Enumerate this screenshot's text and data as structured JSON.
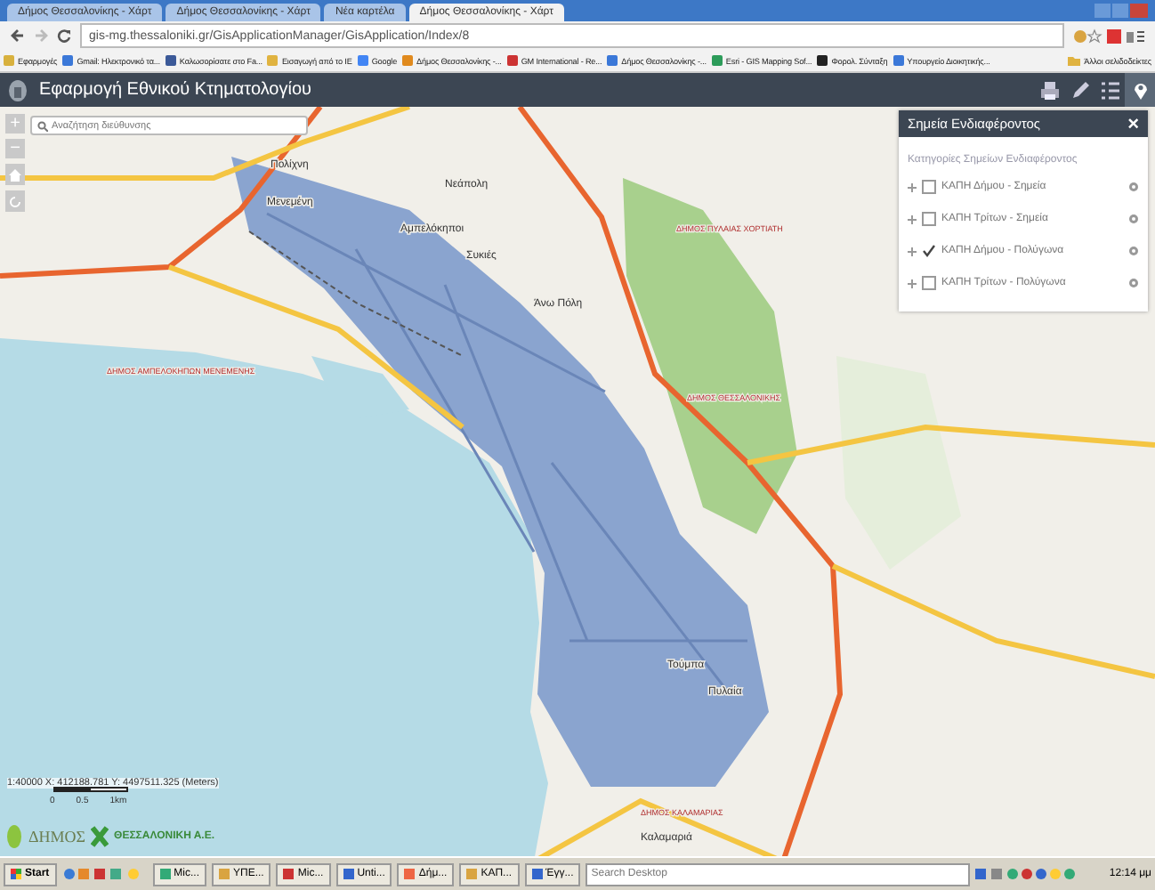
{
  "browser": {
    "tabs": [
      {
        "label": "Δήμος Θεσσαλονίκης - Χάρτ",
        "selected": false
      },
      {
        "label": "Δήμος Θεσσαλονίκης - Χάρτ",
        "selected": false
      },
      {
        "label": "Νέα καρτέλα",
        "selected": false
      },
      {
        "label": "Δήμος Θεσσαλονίκης - Χάρτ",
        "selected": true
      }
    ],
    "url": "gis-mg.thessaloniki.gr/GisApplicationManager/GisApplication/Index/8",
    "bookmarks": [
      "Εφαρμογές",
      "Gmail: Ηλεκτρονικό τα...",
      "Καλωσορίσατε στο Fa...",
      "Εισαγωγή από το IE",
      "Google",
      "Δήμος Θεσσαλονίκης -...",
      "GM International - Re...",
      "Δήμος Θεσσαλονίκης -...",
      "Esri - GIS Mapping Sof...",
      "Φορολ. Σύνταξη",
      "Υπουργείο Διοικητικής..."
    ],
    "other_bookmarks": "Άλλοι σελιδοδείκτες"
  },
  "app": {
    "title": "Εφαρμογή Εθνικού Κτηματολογίου",
    "tools": [
      {
        "kind": "print",
        "selected": false
      },
      {
        "kind": "edit",
        "selected": false
      },
      {
        "kind": "list",
        "selected": false
      },
      {
        "kind": "pin",
        "selected": true
      }
    ]
  },
  "map": {
    "search_placeholder": "Αναζήτηση διεύθυνσης",
    "zoom_controls": [
      "+",
      "−"
    ],
    "place_labels": [
      "Πολίχνη",
      "Μενεμένη",
      "Αμπελόκηποι",
      "Νεάπολη",
      "Συκιές",
      "Άνω Πόλη",
      "Τούμπα",
      "Πυλαία",
      "Καλαμαριά"
    ],
    "district_labels": [
      "ΔΗΜΟΣ ΑΜΠΕΛΟΚΗΠΩΝ ΜΕΝΕΜΕΝΗΣ",
      "ΔΗΜΟΣ ΠΥΛΑΙΑΣ ΧΟΡΤΙΑΤΗ",
      "ΔΗΜΟΣ ΘΕΣΣΑΛΟΝΙΚΗΣ",
      "ΔΗΜΟΣ ΚΑΛΑΜΑΡΙΑΣ"
    ],
    "coordinates": "1:40000  X: 412188.781  Y: 4497511.325 (Meters)",
    "scale_labels": [
      "0",
      "0.5",
      "1km"
    ],
    "logo_texts": [
      "ΔΗΜΟΣ",
      "ΘΕΣΣΑΛΟΝΙΚΗ Α.Ε."
    ]
  },
  "poi_panel": {
    "title": "Σημεία Ενδιαφέροντος",
    "close": "×",
    "heading": "Κατηγορίες Σημείων Ενδιαφέροντος",
    "items": [
      {
        "label": "ΚΑΠΗ Δήμου - Σημεία",
        "checked": false,
        "expanded": false
      },
      {
        "label": "ΚΑΠΗ Τρίτων - Σημεία",
        "checked": false,
        "expanded": false
      },
      {
        "label": "ΚΑΠΗ Δήμου - Πολύγωνα",
        "checked": true,
        "expanded": false
      },
      {
        "label": "ΚΑΠΗ Τρίτων - Πολύγωνα",
        "checked": false,
        "expanded": false
      }
    ]
  },
  "taskbar": {
    "start": "Start",
    "items": [
      "Mic...",
      "ΥΠΕ...",
      "Mic...",
      "Unti...",
      "Δήμ...",
      "ΚΑΠ...",
      "Έγγ..."
    ],
    "search_placeholder": "Search Desktop",
    "clock": "12:14 μμ"
  }
}
